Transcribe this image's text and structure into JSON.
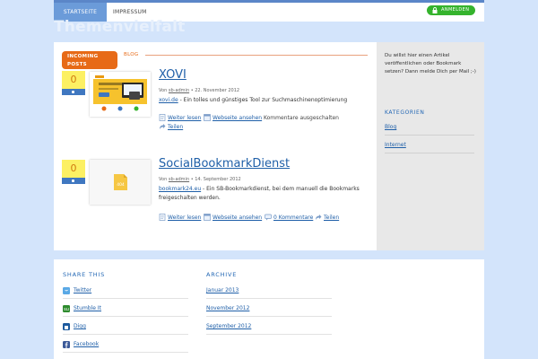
{
  "nav": {
    "items": [
      "Startseite",
      "Impressum"
    ],
    "login_label": "ANMELDEN"
  },
  "site": {
    "title": "Themenvielfalt"
  },
  "section": {
    "incoming_label": "INCOMING POSTS",
    "blog_label": "BLOG"
  },
  "posts": [
    {
      "votes": "0",
      "title": "XOVI",
      "meta_prefix": "Von ",
      "author": "sb-admin",
      "date": " • 22. November 2012",
      "source": "xovi.de",
      "excerpt": " - Ein tolles und günstiges Tool zur Suchmaschinenoptimierung",
      "actions": {
        "read_more": "Weiter lesen",
        "view_site": "Webseite ansehen",
        "comments": "Kommentare ausgeschalten",
        "share": "Teilen"
      }
    },
    {
      "votes": "0",
      "title": "SocialBookmarkDienst",
      "meta_prefix": "Von ",
      "author": "sb-admin",
      "date": " • 14. September 2012",
      "source": "bookmark24.eu",
      "excerpt": " - Ein SB-Bookmarkdienst, bei dem manuell die Bookmarks freigeschalten werden.",
      "actions": {
        "read_more": "Weiter lesen",
        "view_site": "Webseite ansehen",
        "comments": "0 Kommentare",
        "share": "Teilen"
      }
    }
  ],
  "sidebar": {
    "intro": "Du willst hier einen Artikel veröffentlichen oder Bookmark setzen? Dann melde Dich per Mail ;-)",
    "categories_heading": "KATEGORIEN",
    "categories": [
      "Blog",
      "Internet"
    ]
  },
  "footer": {
    "share_heading": "SHARE THIS",
    "share_items": [
      "Twitter",
      "Stumble It",
      "Digg",
      "Facebook"
    ],
    "archive_heading": "ARCHIVE",
    "archive_items": [
      "Januar 2013",
      "November 2012",
      "September 2012"
    ]
  },
  "colors": {
    "accent": "#e76a17",
    "link": "#1f5fa8",
    "nav_active": "#6b9bd9",
    "login": "#35b32d",
    "vote": "#fcf063"
  }
}
